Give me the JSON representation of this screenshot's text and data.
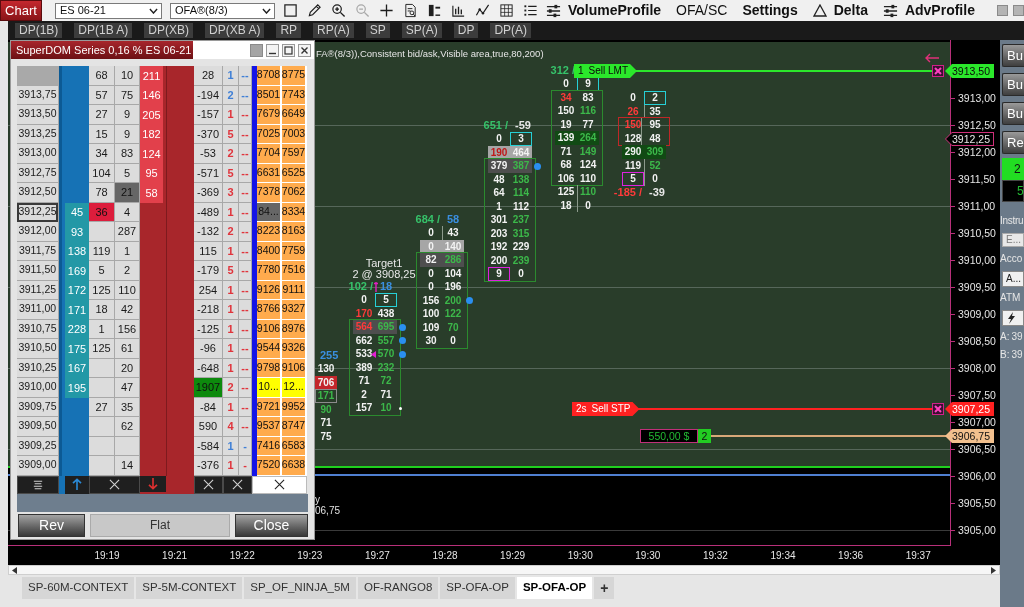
{
  "toolbar": {
    "chart_button": "Chart",
    "instrument": "ES 06-21",
    "indicator": "OFA®(8/3)",
    "tools": [
      {
        "kind": "select",
        "disabled": false
      },
      {
        "kind": "pencil",
        "disabled": false
      },
      {
        "kind": "zoom_in",
        "disabled": false
      },
      {
        "kind": "zoom_out",
        "disabled": true
      },
      {
        "kind": "crosshair",
        "disabled": false
      },
      {
        "kind": "data_box",
        "disabled": false
      },
      {
        "kind": "bar_chart",
        "disabled": false
      },
      {
        "kind": "bracket",
        "disabled": false
      },
      {
        "kind": "line_chart",
        "disabled": false
      },
      {
        "kind": "grid",
        "disabled": false
      },
      {
        "kind": "list",
        "disabled": false
      }
    ],
    "menus": [
      {
        "label": "VolumeProfile",
        "kind": "sliders",
        "bold": true
      },
      {
        "label": "OFA/SC",
        "kind": "plain",
        "bold": false
      },
      {
        "label": "Settings",
        "kind": "plain",
        "bold": true
      },
      {
        "label": "Delta",
        "kind": "triangle",
        "bold": true
      },
      {
        "label": "AdvProfile",
        "kind": "sliders",
        "bold": true
      }
    ]
  },
  "filters": [
    "DP(1B)",
    "DP(1B A)",
    "DP(XB)",
    "DP(XB A)",
    "RP",
    "RP(A)",
    "SP",
    "SP(A)",
    "DP",
    "DP(A)"
  ],
  "chart": {
    "header": "FA®(8/3)),Consistent bid/ask,Visible area,true,80,200)",
    "clusters": [
      {
        "kind": "partial",
        "header": {
          "parts": [
            {
              "text": "255",
              "color": "#3a8fe0"
            }
          ]
        },
        "segments": [
          {
            "kind": "open",
            "rows": [
              {
                "kind": "plain",
                "cells": [
                  {
                    "kind": "plain",
                    "text": "130"
                  }
                ]
              },
              {
                "kind": "sell",
                "cells": [
                  {
                    "kind": "plain",
                    "text": "706"
                  }
                ]
              },
              {
                "kind": "plain",
                "cells": [
                  {
                    "kind": "neutral",
                    "text": "171"
                  }
                ]
              },
              {
                "kind": "plain",
                "cells": [
                  {
                    "kind": "buy",
                    "text": "90"
                  }
                ]
              },
              {
                "kind": "plain",
                "cells": [
                  {
                    "kind": "plain",
                    "text": "71"
                  }
                ]
              },
              {
                "kind": "plain",
                "cells": [
                  {
                    "kind": "plain",
                    "text": "75"
                  }
                ]
              }
            ]
          }
        ]
      },
      {
        "kind": "full",
        "header": {
          "parts": [
            {
              "text": "102 /",
              "color": "#36c26a"
            },
            {
              "text": "18",
              "color": "#3a8fe0"
            }
          ]
        },
        "segments": [
          {
            "kind": "open",
            "rows": [
              {
                "kind": "plain",
                "cells": [
                  {
                    "kind": "plain",
                    "text": "0"
                  },
                  {
                    "kind": "high",
                    "text": "5"
                  }
                ]
              },
              {
                "kind": "plain",
                "cells": [
                  {
                    "kind": "sell",
                    "text": "170"
                  },
                  {
                    "kind": "plain",
                    "text": "438"
                  }
                ]
              }
            ]
          },
          {
            "kind": "area",
            "rows": [
              {
                "kind": "dark",
                "markers": [
                  {
                    "kind": "dot"
                  }
                ],
                "cells": [
                  {
                    "kind": "sell",
                    "text": "564"
                  },
                  {
                    "kind": "buy",
                    "text": "695"
                  }
                ]
              },
              {
                "kind": "plain",
                "markers": [
                  {
                    "kind": "dot"
                  }
                ],
                "cells": [
                  {
                    "kind": "plain",
                    "text": "662"
                  },
                  {
                    "kind": "buy",
                    "text": "557"
                  }
                ]
              },
              {
                "kind": "plain",
                "markers": [
                  {
                    "kind": "triangle"
                  },
                  {
                    "kind": "dot"
                  }
                ],
                "cells": [
                  {
                    "kind": "plain",
                    "text": "533"
                  },
                  {
                    "kind": "buy",
                    "text": "570"
                  }
                ]
              },
              {
                "kind": "plain",
                "cells": [
                  {
                    "kind": "plain",
                    "text": "389"
                  },
                  {
                    "kind": "buy",
                    "text": "232"
                  }
                ]
              },
              {
                "kind": "plain",
                "cells": [
                  {
                    "kind": "plain",
                    "text": "71"
                  },
                  {
                    "kind": "buy",
                    "text": "72"
                  }
                ]
              },
              {
                "kind": "plain",
                "cells": [
                  {
                    "kind": "plain",
                    "text": "2"
                  },
                  {
                    "kind": "plain",
                    "text": "71"
                  }
                ]
              },
              {
                "kind": "plain",
                "markers": [
                  {
                    "kind": "pin"
                  }
                ],
                "cells": [
                  {
                    "kind": "plain",
                    "text": "157"
                  },
                  {
                    "kind": "buy",
                    "text": "10"
                  }
                ]
              }
            ]
          }
        ]
      },
      {
        "kind": "full",
        "header": {
          "parts": [
            {
              "text": "684 /",
              "color": "#36c26a"
            },
            {
              "text": "58",
              "color": "#3a8fe0"
            }
          ]
        },
        "segments": [
          {
            "kind": "stem",
            "rows": [
              {
                "kind": "plain",
                "cells": [
                  {
                    "kind": "plain",
                    "text": "0"
                  },
                  {
                    "kind": "plain",
                    "text": "43"
                  }
                ]
              },
              {
                "kind": "light",
                "cells": [
                  {
                    "kind": "plain",
                    "text": "0"
                  },
                  {
                    "kind": "plain",
                    "text": "140"
                  }
                ]
              }
            ]
          },
          {
            "kind": "area",
            "rows": [
              {
                "kind": "dark",
                "cells": [
                  {
                    "kind": "plain",
                    "text": "82"
                  },
                  {
                    "kind": "buy",
                    "text": "286"
                  }
                ]
              },
              {
                "kind": "plain",
                "cells": [
                  {
                    "kind": "plain",
                    "text": "0"
                  },
                  {
                    "kind": "plain",
                    "text": "104"
                  }
                ]
              },
              {
                "kind": "plain",
                "cells": [
                  {
                    "kind": "plain",
                    "text": "0"
                  },
                  {
                    "kind": "plain",
                    "text": "196"
                  }
                ]
              },
              {
                "kind": "plain",
                "markers": [
                  {
                    "kind": "dot"
                  }
                ],
                "cells": [
                  {
                    "kind": "plain",
                    "text": "156"
                  },
                  {
                    "kind": "buy",
                    "text": "200"
                  }
                ]
              },
              {
                "kind": "plain",
                "cells": [
                  {
                    "kind": "plain",
                    "text": "100"
                  },
                  {
                    "kind": "buy",
                    "text": "122"
                  }
                ]
              },
              {
                "kind": "plain",
                "cells": [
                  {
                    "kind": "plain",
                    "text": "109"
                  },
                  {
                    "kind": "buy",
                    "text": "70"
                  }
                ]
              },
              {
                "kind": "plain",
                "cells": [
                  {
                    "kind": "plain",
                    "text": "30"
                  },
                  {
                    "kind": "plain",
                    "text": "0"
                  }
                ]
              }
            ]
          }
        ]
      },
      {
        "kind": "full",
        "header": {
          "parts": [
            {
              "text": "651 /",
              "color": "#36c26a"
            },
            {
              "text": "-59"
            }
          ]
        },
        "segments": [
          {
            "kind": "open",
            "rows": [
              {
                "kind": "plain",
                "cells": [
                  {
                    "kind": "plain",
                    "text": "0"
                  },
                  {
                    "kind": "high",
                    "text": "3"
                  }
                ]
              },
              {
                "kind": "light",
                "cells": [
                  {
                    "kind": "sell",
                    "text": "190"
                  },
                  {
                    "kind": "plain",
                    "text": "464"
                  }
                ]
              }
            ]
          },
          {
            "kind": "area",
            "rows": [
              {
                "kind": "dark",
                "markers": [
                  {
                    "kind": "dot"
                  }
                ],
                "cells": [
                  {
                    "kind": "plain",
                    "text": "379"
                  },
                  {
                    "kind": "buy",
                    "text": "387"
                  }
                ]
              },
              {
                "kind": "plain",
                "cells": [
                  {
                    "kind": "plain",
                    "text": "48"
                  },
                  {
                    "kind": "buy",
                    "text": "138"
                  }
                ]
              },
              {
                "kind": "plain",
                "cells": [
                  {
                    "kind": "plain",
                    "text": "64"
                  },
                  {
                    "kind": "buy",
                    "text": "114"
                  }
                ]
              },
              {
                "kind": "plain",
                "cells": [
                  {
                    "kind": "plain",
                    "text": "1"
                  },
                  {
                    "kind": "plain",
                    "text": "112"
                  }
                ]
              },
              {
                "kind": "plain",
                "cells": [
                  {
                    "kind": "plain",
                    "text": "301"
                  },
                  {
                    "kind": "buy",
                    "text": "237"
                  }
                ]
              },
              {
                "kind": "plain",
                "cells": [
                  {
                    "kind": "plain",
                    "text": "203"
                  },
                  {
                    "kind": "buy",
                    "text": "315"
                  }
                ]
              },
              {
                "kind": "plain",
                "cells": [
                  {
                    "kind": "plain",
                    "text": "192"
                  },
                  {
                    "kind": "plain",
                    "text": "229"
                  }
                ]
              },
              {
                "kind": "plain",
                "cells": [
                  {
                    "kind": "plain",
                    "text": "200"
                  },
                  {
                    "kind": "buy",
                    "text": "239"
                  }
                ]
              },
              {
                "kind": "plain",
                "cells": [
                  {
                    "kind": "low",
                    "text": "9"
                  },
                  {
                    "kind": "plain",
                    "text": "0"
                  }
                ]
              }
            ]
          }
        ]
      },
      {
        "kind": "full",
        "header": {
          "parts": [
            {
              "text": "312 /",
              "color": "#36c26a"
            }
          ]
        },
        "segments": [
          {
            "kind": "open",
            "rows": [
              {
                "kind": "plain",
                "cells": [
                  {
                    "kind": "plain",
                    "text": "0"
                  },
                  {
                    "kind": "high",
                    "text": "9"
                  }
                ]
              }
            ]
          },
          {
            "kind": "area",
            "rows": [
              {
                "kind": "plain",
                "cells": [
                  {
                    "kind": "sell",
                    "text": "34"
                  },
                  {
                    "kind": "plain",
                    "text": "83"
                  }
                ]
              },
              {
                "kind": "plain",
                "cells": [
                  {
                    "kind": "plain",
                    "text": "150"
                  },
                  {
                    "kind": "buy",
                    "text": "116"
                  }
                ]
              },
              {
                "kind": "plain",
                "cells": [
                  {
                    "kind": "plain",
                    "text": "19"
                  },
                  {
                    "kind": "plain",
                    "text": "77"
                  }
                ]
              },
              {
                "kind": "peak",
                "cells": [
                  {
                    "kind": "plain",
                    "text": "139"
                  },
                  {
                    "kind": "buy",
                    "text": "264"
                  }
                ]
              },
              {
                "kind": "plain",
                "cells": [
                  {
                    "kind": "plain",
                    "text": "71"
                  },
                  {
                    "kind": "buy",
                    "text": "149"
                  }
                ]
              },
              {
                "kind": "plain",
                "cells": [
                  {
                    "kind": "plain",
                    "text": "68"
                  },
                  {
                    "kind": "plain",
                    "text": "124"
                  }
                ]
              },
              {
                "kind": "plain",
                "cells": [
                  {
                    "kind": "plain",
                    "text": "106"
                  },
                  {
                    "kind": "plain",
                    "text": "110"
                  }
                ]
              }
            ]
          },
          {
            "kind": "stem",
            "rows": [
              {
                "kind": "plain",
                "cells": [
                  {
                    "kind": "plain",
                    "text": "125"
                  },
                  {
                    "kind": "buy",
                    "text": "110"
                  }
                ]
              },
              {
                "kind": "plain",
                "cells": [
                  {
                    "kind": "plain",
                    "text": "18"
                  },
                  {
                    "kind": "plain",
                    "text": "0"
                  }
                ]
              }
            ]
          }
        ]
      },
      {
        "kind": "full",
        "footer": {
          "parts": [
            {
              "text": "-185 /",
              "color": "#ff3a3a"
            },
            {
              "text": "-39"
            }
          ]
        },
        "segments": [
          {
            "kind": "stem",
            "rows": [
              {
                "kind": "plain",
                "cells": [
                  {
                    "kind": "plain",
                    "text": "0"
                  },
                  {
                    "kind": "high",
                    "text": "2"
                  }
                ]
              },
              {
                "kind": "plain",
                "cells": [
                  {
                    "kind": "sell",
                    "text": "26"
                  },
                  {
                    "kind": "plain",
                    "text": "35"
                  }
                ]
              }
            ]
          },
          {
            "kind": "imbalance",
            "rows": [
              {
                "kind": "plain",
                "cells": [
                  {
                    "kind": "sell",
                    "text": "150"
                  },
                  {
                    "kind": "plain",
                    "text": "95"
                  }
                ]
              },
              {
                "kind": "plain",
                "cells": [
                  {
                    "kind": "plain",
                    "text": "128"
                  },
                  {
                    "kind": "plain",
                    "text": "48"
                  }
                ]
              }
            ]
          },
          {
            "kind": "stem",
            "rows": [
              {
                "kind": "peak",
                "cells": [
                  {
                    "kind": "plain",
                    "text": "290"
                  },
                  {
                    "kind": "buy",
                    "text": "309"
                  }
                ]
              },
              {
                "kind": "plain",
                "cells": [
                  {
                    "kind": "plain",
                    "text": "119"
                  },
                  {
                    "kind": "buy",
                    "text": "52"
                  }
                ]
              },
              {
                "kind": "plain",
                "cells": [
                  {
                    "kind": "low",
                    "text": "5"
                  },
                  {
                    "kind": "plain",
                    "text": "0"
                  }
                ]
              }
            ]
          }
        ]
      }
    ],
    "target_label": {
      "title": "Target1",
      "detail": "2 @ 3908,25"
    },
    "entry_label": {
      "title": "y",
      "detail": "06,75"
    },
    "orders": [
      {
        "kind": "limit",
        "quantity": "1",
        "label": "Sell LMT",
        "price": "3913,50"
      },
      {
        "kind": "stop",
        "quantity": "2s",
        "label": "Sell STP",
        "price": "3907,25"
      }
    ],
    "position": {
      "pnl": "550,00 $",
      "quantity": "2",
      "price": "3906,75"
    },
    "last_price": "3912,25",
    "price_axis": [
      "3913,00",
      "3912,50",
      "3912,00",
      "3911,50",
      "3911,00",
      "3910,50",
      "3910,00",
      "3909,50",
      "3909,00",
      "3908,50",
      "3908,00",
      "3907,50",
      "3907,00",
      "3906,50",
      "3906,00",
      "3905,50",
      "3905,00"
    ],
    "time_axis": [
      "19:19",
      "19:21",
      "19:22",
      "19:23",
      "19:27",
      "19:28",
      "19:29",
      "19:30",
      "19:30",
      "19:32",
      "19:34",
      "19:36",
      "19:37"
    ]
  },
  "dom": {
    "title": "SuperDOM Series 0,16 % ES 06-21",
    "rows": [
      {
        "column_3": "68",
        "column_4": "10",
        "column_5": "211",
        "column_7": "28",
        "column_8": "1",
        "column_9": "--",
        "color": "#3f7fd6",
        "column_11": "8708",
        "column_12": "8775",
        "current": false
      },
      {
        "price": "3913,75",
        "column_3": "57",
        "column_4": "75",
        "column_5": "146",
        "column_7": "-194",
        "column_8": "2",
        "column_9": "--",
        "color": "#3f7fd6",
        "column_11": "8501",
        "column_12": "7743",
        "current": false
      },
      {
        "price": "3913,50",
        "column_3": "27",
        "column_4": "9",
        "column_5": "205",
        "column_7": "-157",
        "column_8": "1",
        "column_9": "--",
        "color": "#e0343c",
        "column_11": "7679",
        "column_12": "6649",
        "current": false
      },
      {
        "price": "3913,25",
        "column_3": "15",
        "column_4": "9",
        "column_5": "182",
        "column_7": "-370",
        "column_8": "5",
        "column_9": "--",
        "color": "#e0343c",
        "column_11": "7025",
        "column_12": "7003",
        "current": false
      },
      {
        "price": "3913,00",
        "column_3": "34",
        "column_4": "83",
        "column_5": "124",
        "column_7": "-53",
        "column_8": "2",
        "column_9": "--",
        "color": "#e0343c",
        "column_11": "7704",
        "column_12": "7597",
        "current": false
      },
      {
        "price": "3912,75",
        "column_3": "104",
        "column_4": "5",
        "column_5": "95",
        "column_7": "-571",
        "column_8": "5",
        "column_9": "--",
        "color": "#e0343c",
        "column_11": "6631",
        "column_12": "6525",
        "current": false
      },
      {
        "price": "3912,50",
        "column_3": "78",
        "column_4": {
          "text": "21",
          "kind": "dark"
        },
        "column_5": "58",
        "column_7": "-369",
        "column_8": "3",
        "column_9": "--",
        "color": "#e0343c",
        "column_11": "7378",
        "column_12": "7062",
        "current": false
      },
      {
        "price": "3912,25",
        "column_2": "45",
        "column_3": {
          "text": "36",
          "kind": "hot"
        },
        "column_4": "4",
        "column_7": "-489",
        "column_8": "1",
        "column_9": "--",
        "color": "#e0343c",
        "column_11": {
          "text": "84...",
          "kind": "dark"
        },
        "column_12": "8334",
        "current": true
      },
      {
        "price": "3912,00",
        "column_2": "93",
        "column_4": "287",
        "column_7": "-132",
        "column_8": "2",
        "column_9": "--",
        "color": "#e0343c",
        "column_11": "8223",
        "column_12": "8163",
        "current": false
      },
      {
        "price": "3911,75",
        "column_2": "138",
        "column_3": "119",
        "column_4": "1",
        "column_7": "115",
        "column_8": "1",
        "column_9": "--",
        "color": "#e0343c",
        "column_11": "8400",
        "column_12": "7759",
        "current": false
      },
      {
        "price": "3911,50",
        "column_2": "169",
        "column_3": "5",
        "column_4": "2",
        "column_7": "-179",
        "column_8": "5",
        "column_9": "--",
        "color": "#e0343c",
        "column_11": "7780",
        "column_12": "7516",
        "current": false
      },
      {
        "price": "3911,25",
        "column_2": "172",
        "column_3": "125",
        "column_4": "110",
        "column_7": "254",
        "column_8": "1",
        "column_9": "--",
        "color": "#e0343c",
        "column_11": "9126",
        "column_12": "9111",
        "current": false
      },
      {
        "price": "3911,00",
        "column_2": "171",
        "column_3": "18",
        "column_4": "42",
        "column_7": "-218",
        "column_8": "1",
        "column_9": "--",
        "color": "#e0343c",
        "column_11": "8766",
        "column_12": "9327",
        "current": false
      },
      {
        "price": "3910,75",
        "column_2": "228",
        "column_3": "1",
        "column_4": "156",
        "column_7": "-125",
        "column_8": "1",
        "column_9": "--",
        "color": "#e0343c",
        "column_11": "9106",
        "column_12": "8976",
        "current": false
      },
      {
        "price": "3910,50",
        "column_2": "175",
        "column_3": "125",
        "column_4": "61",
        "column_7": "-96",
        "column_8": "1",
        "column_9": "--",
        "color": "#e0343c",
        "column_11": "9544",
        "column_12": "9326",
        "current": false
      },
      {
        "price": "3910,25",
        "column_2": "167",
        "column_4": "20",
        "column_7": "-648",
        "column_8": "1",
        "column_9": "--",
        "color": "#e0343c",
        "column_11": "9798",
        "column_12": "9106",
        "current": false
      },
      {
        "price": "3910,00",
        "column_2": "195",
        "column_4": "47",
        "column_7": {
          "text": "1907",
          "kind": "strong"
        },
        "column_8": "2",
        "column_9": "--",
        "color": "#e0343c",
        "column_11": {
          "text": "10...",
          "kind": "max"
        },
        "column_12": {
          "text": "12...",
          "kind": "max"
        },
        "current": false
      },
      {
        "price": "3909,75",
        "column_3": "27",
        "column_4": "35",
        "column_7": "-84",
        "column_8": "1",
        "column_9": "--",
        "color": "#e0343c",
        "column_11": "9721",
        "column_12": "9952",
        "current": false
      },
      {
        "price": "3909,50",
        "column_4": "62",
        "column_7": "590",
        "column_8": "4",
        "column_9": "--",
        "color": "#e0343c",
        "column_11": "9537",
        "column_12": "8747",
        "current": false
      },
      {
        "price": "3909,25",
        "column_7": "-584",
        "column_8": "1",
        "column_9": "-",
        "color": "#3f7fd6",
        "column_11": "7416",
        "column_12": "6583",
        "current": false
      },
      {
        "price": "3909,00",
        "column_4": "14",
        "column_7": "-376",
        "column_8": "1",
        "column_9": "-",
        "color": "#e0343c",
        "column_11": "7520",
        "column_12": "6638",
        "current": false
      }
    ],
    "buttons": [
      {
        "label": "Rev",
        "kind": "action"
      },
      {
        "label": "Flat",
        "kind": "plain"
      },
      {
        "label": "Close",
        "kind": "action"
      }
    ]
  },
  "order_panel": {
    "buttons": [
      "Bu",
      "Bu",
      "Bu",
      "Re"
    ],
    "quantity": "2",
    "pnl": "5",
    "instrument_label": "Instru",
    "instrument_value": "E...",
    "account_label": "Acco",
    "account_value": "A...",
    "atm_label": "ATM",
    "quotes": [
      {
        "label": "A:",
        "value": "39"
      },
      {
        "label": "B:",
        "value": "39"
      }
    ]
  },
  "tabs": [
    {
      "label": "SP-60M-CONTEXT",
      "selected": false
    },
    {
      "label": "SP-5M-CONTEXT",
      "selected": false
    },
    {
      "label": "SP_OF_NINJA_5M",
      "selected": false
    },
    {
      "label": "OF-RANGO8",
      "selected": false
    },
    {
      "label": "SP-OFA-OP",
      "selected": false
    },
    {
      "label": "SP-OFA-OP",
      "selected": true
    }
  ],
  "add_tab": "+"
}
